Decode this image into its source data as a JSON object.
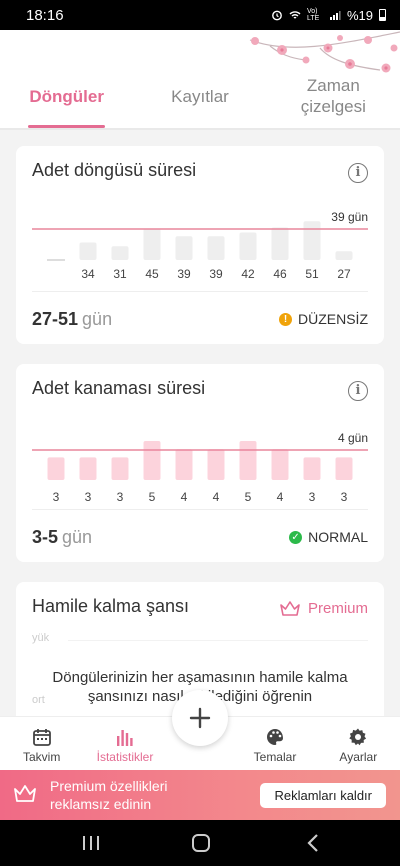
{
  "status_bar": {
    "time": "18:16",
    "network": "Vo) LTE",
    "battery": "%19"
  },
  "tabs": [
    {
      "label": "Döngüler",
      "active": true
    },
    {
      "label": "Kayıtlar",
      "active": false
    },
    {
      "label_line1": "Zaman",
      "label_line2": "çizelgesi",
      "active": false
    }
  ],
  "cycle_card": {
    "title": "Adet döngüsü süresi",
    "average_label": "39 gün",
    "range_value": "27-51",
    "range_unit": "gün",
    "status": "DÜZENSİZ",
    "status_color": "#f0a30a"
  },
  "period_card": {
    "title": "Adet kanaması süresi",
    "average_label": "4 gün",
    "range_value": "3-5",
    "range_unit": "gün",
    "status": "NORMAL",
    "status_color": "#2cba4a"
  },
  "pregnancy_card": {
    "title": "Hamile kalma şansı",
    "premium_label": "Premium",
    "faint_labels": [
      "yük",
      "ort"
    ],
    "promo_line1": "Döngülerinizin her aşamasının hamile kalma",
    "promo_line2": "şansınızı nasıl etkilediğini öğrenin"
  },
  "bottom_nav": [
    {
      "label": "Takvim",
      "icon": "calendar-icon",
      "active": false
    },
    {
      "label": "İstatistikler",
      "icon": "bar-chart-icon",
      "active": true
    },
    {
      "label": "Temalar",
      "icon": "palette-icon",
      "active": false
    },
    {
      "label": "Ayarlar",
      "icon": "gear-icon",
      "active": false
    }
  ],
  "ad_banner": {
    "line1": "Premium özellikleri",
    "line2": "reklamsız edinin",
    "button_label": "Reklamları kaldır"
  },
  "colors": {
    "accent": "#e46c92",
    "bar_grey": "#eeeeee",
    "bar_pink": "#fcd3dc",
    "line": "#e9859c"
  },
  "chart_data": [
    {
      "type": "bar",
      "title": "Adet döngüsü süresi",
      "categories": [
        "",
        "34",
        "31",
        "45",
        "39",
        "39",
        "42",
        "46",
        "51",
        "27"
      ],
      "values": [
        0,
        34,
        31,
        45,
        39,
        39,
        42,
        46,
        51,
        27
      ],
      "average": 39,
      "average_label": "39 gün",
      "value_labels": [
        "",
        "34",
        "31",
        "45",
        "39",
        "39",
        "42",
        "46",
        "51",
        "27"
      ]
    },
    {
      "type": "bar",
      "title": "Adet kanaması süresi",
      "categories": [
        "3",
        "3",
        "3",
        "5",
        "4",
        "4",
        "5",
        "4",
        "3",
        "3"
      ],
      "values": [
        3,
        3,
        3,
        5,
        4,
        4,
        5,
        4,
        3,
        3
      ],
      "average": 4,
      "average_label": "4 gün",
      "value_labels": [
        "3",
        "3",
        "3",
        "5",
        "4",
        "4",
        "5",
        "4",
        "3",
        "3"
      ]
    }
  ]
}
